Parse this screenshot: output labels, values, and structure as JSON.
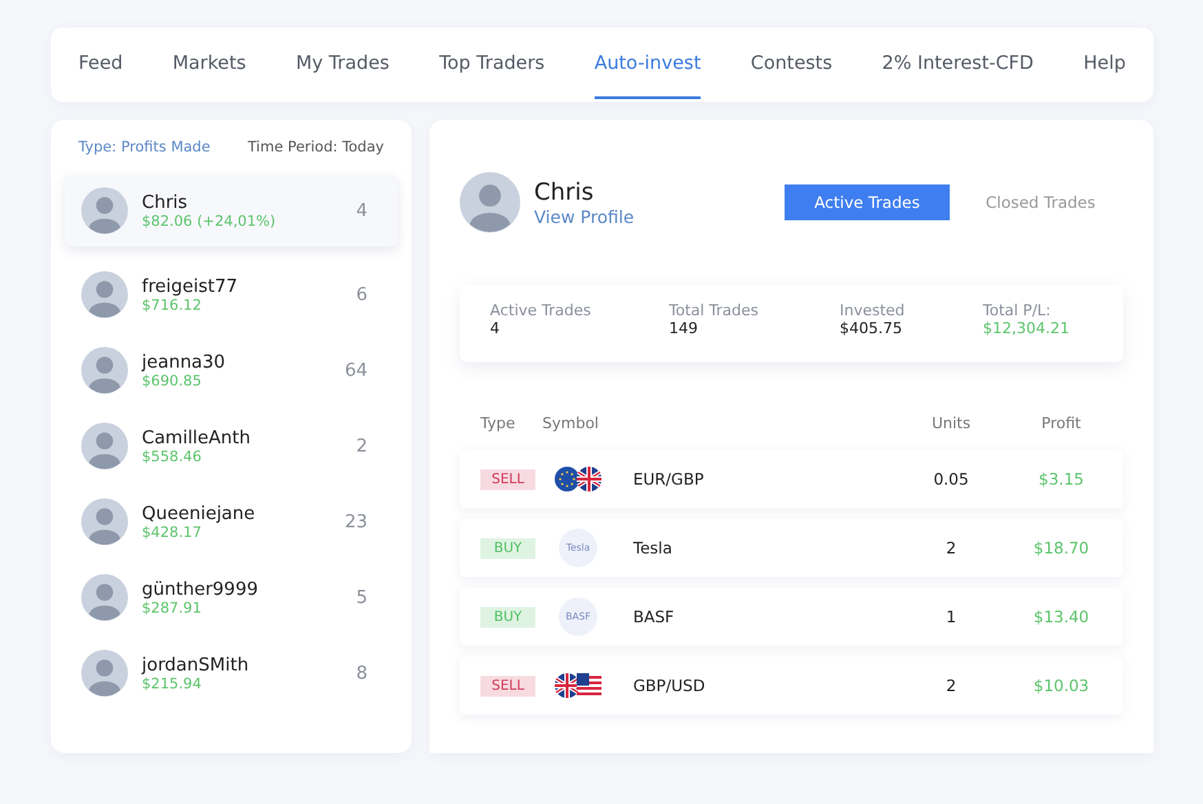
{
  "nav": [
    {
      "label": "Feed",
      "selected": false
    },
    {
      "label": "Markets",
      "selected": false
    },
    {
      "label": "My Trades",
      "selected": false
    },
    {
      "label": "Top Traders",
      "selected": false
    },
    {
      "label": "Auto-invest",
      "selected": true
    },
    {
      "label": "Contests",
      "selected": false
    },
    {
      "label": "2% Interest-CFD",
      "selected": false
    },
    {
      "label": "Help",
      "selected": false
    }
  ],
  "filters": {
    "type": "Type: Profits Made",
    "period": "Time Period: Today"
  },
  "traders": [
    {
      "name": "Chris",
      "profit": "$82.06 (+24,01%)",
      "count": "4",
      "selected": true
    },
    {
      "name": "freigeist77",
      "profit": "$716.12",
      "count": "6",
      "selected": false
    },
    {
      "name": "jeanna30",
      "profit": "$690.85",
      "count": "64",
      "selected": false
    },
    {
      "name": "CamilleAnth",
      "profit": "$558.46",
      "count": "2",
      "selected": false
    },
    {
      "name": "Queeniejane",
      "profit": "$428.17",
      "count": "23",
      "selected": false
    },
    {
      "name": "günther9999",
      "profit": "$287.91",
      "count": "5",
      "selected": false
    },
    {
      "name": "jordanSMith",
      "profit": "$215.94",
      "count": "8",
      "selected": false
    }
  ],
  "profile": {
    "name": "Chris",
    "link": "View Profile"
  },
  "trade_tabs": [
    {
      "label": "Active Trades",
      "selected": true
    },
    {
      "label": "Closed Trades",
      "selected": false
    }
  ],
  "stats": [
    {
      "label": "Active Trades",
      "value": "4",
      "kind": "plain"
    },
    {
      "label": "Total Trades",
      "value": "149",
      "kind": "plain"
    },
    {
      "label": "Invested",
      "value": "$405.75",
      "kind": "plain"
    },
    {
      "label": "Total P/L:",
      "value": "$12,304.21",
      "kind": "gain"
    }
  ],
  "table": {
    "columns": [
      "Type",
      "Symbol",
      "Units",
      "Profit"
    ],
    "rows": [
      {
        "type": "SELL",
        "color": "#d03a5a",
        "kind": "eurgbp",
        "symbol": "EUR/GBP",
        "units": "0.05",
        "profit": "$3.15"
      },
      {
        "type": "BUY",
        "color": "#4fbf62",
        "kind": "company",
        "logo_text": "Tesla",
        "symbol": "Tesla",
        "units": "2",
        "profit": "$18.70"
      },
      {
        "type": "BUY",
        "color": "#4fbf62",
        "kind": "company",
        "logo_text": "BASF",
        "symbol": "BASF",
        "units": "1",
        "profit": "$13.40"
      },
      {
        "type": "SELL",
        "color": "#d03a5a",
        "kind": "gbpusd",
        "symbol": "GBP/USD",
        "units": "2",
        "profit": "$10.03"
      }
    ]
  }
}
